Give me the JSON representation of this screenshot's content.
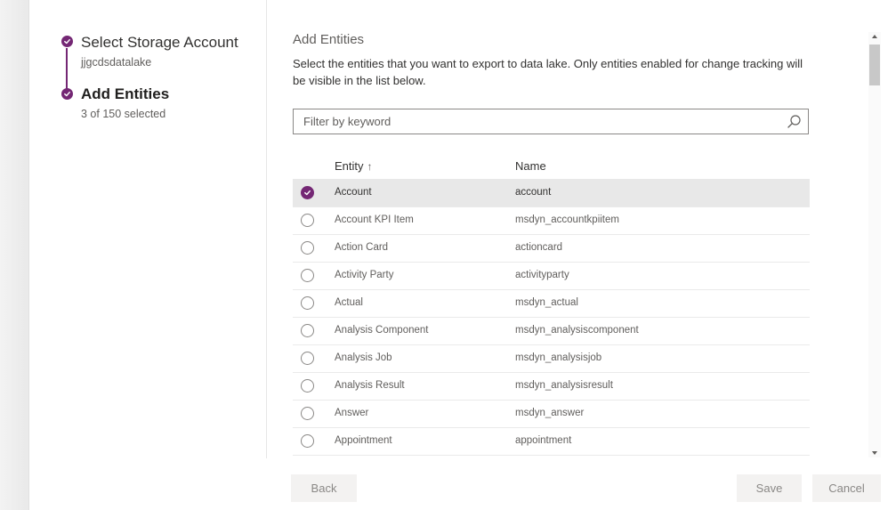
{
  "steps": [
    {
      "title": "Select Storage Account",
      "subtitle": "jjgcdsdatalake",
      "state": "completed"
    },
    {
      "title": "Add Entities",
      "subtitle": "3 of 150 selected",
      "state": "current"
    }
  ],
  "main": {
    "title": "Add Entities",
    "description": "Select the entities that you want to export to data lake. Only entities enabled for change tracking will be visible in the list below.",
    "filter": {
      "placeholder": "Filter by keyword",
      "value": ""
    }
  },
  "table": {
    "columns": {
      "entity": "Entity",
      "name": "Name",
      "sort_icon": "arrow-up-icon",
      "sort_glyph": "↑"
    },
    "rows": [
      {
        "entity": "Account",
        "name": "account",
        "selected": true
      },
      {
        "entity": "Account KPI Item",
        "name": "msdyn_accountkpiitem",
        "selected": false
      },
      {
        "entity": "Action Card",
        "name": "actioncard",
        "selected": false
      },
      {
        "entity": "Activity Party",
        "name": "activityparty",
        "selected": false
      },
      {
        "entity": "Actual",
        "name": "msdyn_actual",
        "selected": false
      },
      {
        "entity": "Analysis Component",
        "name": "msdyn_analysiscomponent",
        "selected": false
      },
      {
        "entity": "Analysis Job",
        "name": "msdyn_analysisjob",
        "selected": false
      },
      {
        "entity": "Analysis Result",
        "name": "msdyn_analysisresult",
        "selected": false
      },
      {
        "entity": "Answer",
        "name": "msdyn_answer",
        "selected": false
      },
      {
        "entity": "Appointment",
        "name": "appointment",
        "selected": false
      }
    ]
  },
  "buttons": {
    "back": "Back",
    "save": "Save",
    "cancel": "Cancel"
  },
  "colors": {
    "accent": "#742774",
    "selected_row": "#e8e8e8",
    "disabled_text": "#8a8886"
  }
}
